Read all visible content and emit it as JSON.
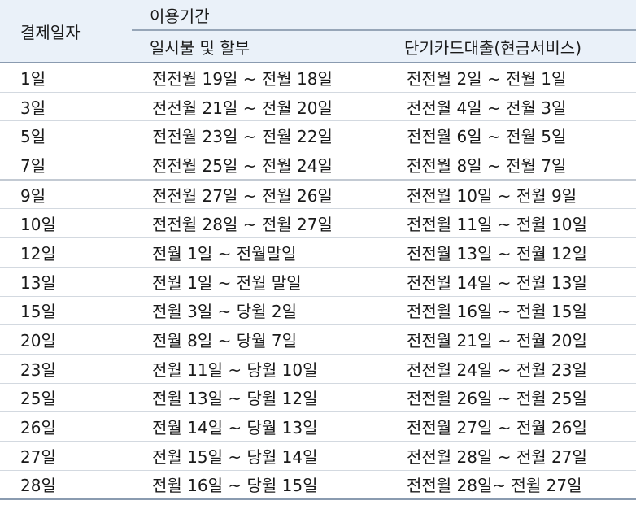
{
  "header": {
    "date_col": "결제일자",
    "period_group": "이용기간",
    "installment_col": "일시불 및 할부",
    "cash_service_col": "단기카드대출(현금서비스)"
  },
  "rows": [
    {
      "date": "1일",
      "installment": "전전월 19일 ~ 전월 18일",
      "cash": "전전월 2일 ~ 전월 1일"
    },
    {
      "date": "3일",
      "installment": "전전월 21일 ~ 전월 20일",
      "cash": "전전월 4일 ~ 전월 3일"
    },
    {
      "date": "5일",
      "installment": "전전월 23일 ~ 전월 22일",
      "cash": "전전월 6일 ~ 전월 5일"
    },
    {
      "date": "7일",
      "installment": "전전월 25일 ~ 전월 24일",
      "cash": "전전월 8일 ~ 전월 7일"
    },
    {
      "date": "9일",
      "installment": "전전월 27일 ~ 전월 26일",
      "cash": "전전월 10일 ~ 전월 9일"
    },
    {
      "date": "10일",
      "installment": "전전월 28일 ~ 전월 27일",
      "cash": "전전월 11일 ~ 전월 10일"
    },
    {
      "date": "12일",
      "installment": "전월 1일 ~ 전월말일",
      "cash": "전전월 13일 ~ 전월 12일"
    },
    {
      "date": "13일",
      "installment": "전월 1일 ~ 전월 말일",
      "cash": "전전월 14일 ~ 전월 13일"
    },
    {
      "date": "15일",
      "installment": "전월 3일 ~ 당월 2일",
      "cash": "전전월 16일 ~ 전월 15일"
    },
    {
      "date": "20일",
      "installment": "전월 8일 ~ 당월 7일",
      "cash": "전전월 21일 ~ 전월 20일"
    },
    {
      "date": "23일",
      "installment": "전월 11일 ~ 당월 10일",
      "cash": "전전월 24일 ~ 전월 23일"
    },
    {
      "date": "25일",
      "installment": "전월 13일 ~ 당월 12일",
      "cash": "전전월 26일 ~ 전월 25일"
    },
    {
      "date": "26일",
      "installment": "전월 14일 ~ 당월 13일",
      "cash": "전전월 27일 ~ 전월 26일"
    },
    {
      "date": "27일",
      "installment": "전월 15일 ~ 당월 14일",
      "cash": "전전월 28일 ~ 전월 27일"
    },
    {
      "date": "28일",
      "installment": "전월 16일 ~ 당월 15일",
      "cash": "전전월 28일~ 전월 27일"
    }
  ]
}
